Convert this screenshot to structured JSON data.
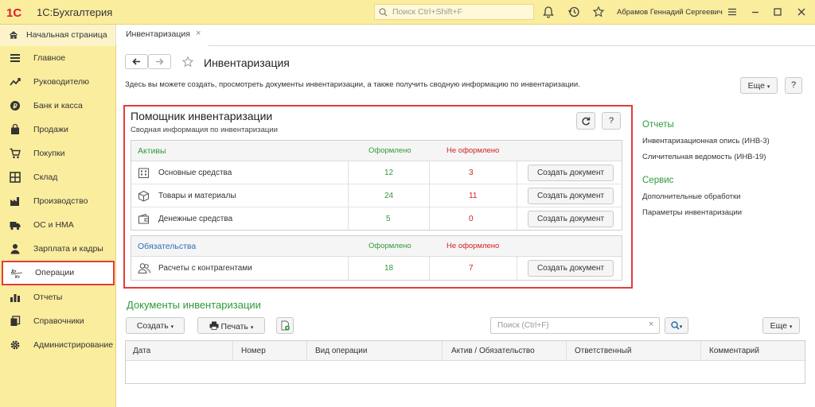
{
  "app": {
    "logo_text": "1С",
    "name": "1С:Бухгалтерия",
    "search_placeholder": "Поиск Ctrl+Shift+F",
    "user": "Абрамов Геннадий Сергеевич"
  },
  "tabs": {
    "home": "Начальная страница",
    "active": "Инвентаризация",
    "close": "×"
  },
  "sidebar": {
    "items": [
      {
        "label": "Главное",
        "icon": "menu-icon"
      },
      {
        "label": "Руководителю",
        "icon": "trend-icon"
      },
      {
        "label": "Банк и касса",
        "icon": "coin-icon"
      },
      {
        "label": "Продажи",
        "icon": "bag-icon"
      },
      {
        "label": "Покупки",
        "icon": "cart-icon"
      },
      {
        "label": "Склад",
        "icon": "warehouse-icon"
      },
      {
        "label": "Производство",
        "icon": "factory-icon"
      },
      {
        "label": "ОС и НМА",
        "icon": "truck-icon"
      },
      {
        "label": "Зарплата и кадры",
        "icon": "person-icon"
      },
      {
        "label": "Операции",
        "icon": "dt-kt-icon",
        "icon_text": [
          "Дт",
          "Кт"
        ]
      },
      {
        "label": "Отчеты",
        "icon": "bar-chart-icon"
      },
      {
        "label": "Справочники",
        "icon": "books-icon"
      },
      {
        "label": "Администрирование",
        "icon": "gear-icon"
      }
    ]
  },
  "page": {
    "title": "Инвентаризация",
    "description": "Здесь вы можете создать, просмотреть документы инвентаризации, а также получить сводную информацию по инвентаризации.",
    "more_button": "Еще",
    "help_button": "?"
  },
  "wizard": {
    "title": "Помощник инвентаризации",
    "subtitle": "Сводная информация по инвентаризации",
    "refresh_icon": "refresh-icon",
    "help_button": "?",
    "assets": {
      "header": "Активы",
      "col_done": "Оформлено",
      "col_notdone": "Не оформлено",
      "rows": [
        {
          "label": "Основные средства",
          "done": "12",
          "notdone": "3",
          "action": "Создать документ"
        },
        {
          "label": "Товары и материалы",
          "done": "24",
          "notdone": "11",
          "action": "Создать документ"
        },
        {
          "label": "Денежные средства",
          "done": "5",
          "notdone": "0",
          "action": "Создать документ"
        }
      ]
    },
    "liabilities": {
      "header": "Обязательства",
      "col_done": "Оформлено",
      "col_notdone": "Не оформлено",
      "rows": [
        {
          "label": "Расчеты с контрагентами",
          "done": "18",
          "notdone": "7",
          "action": "Создать документ"
        }
      ]
    }
  },
  "side_panel": {
    "reports_title": "Отчеты",
    "reports": [
      "Инвентаризационная опись (ИНВ-3)",
      "Сличительная ведомость (ИНВ-19)"
    ],
    "service_title": "Сервис",
    "service": [
      "Дополнительные обработки",
      "Параметры инвентаризации"
    ]
  },
  "documents": {
    "title": "Документы инвентаризации",
    "create_button": "Создать",
    "print_button": "Печать",
    "search_placeholder": "Поиск (Ctrl+F)",
    "clear": "×",
    "more_button": "Еще",
    "columns": [
      "Дата",
      "Номер",
      "Вид операции",
      "Актив / Обязательство",
      "Ответственный",
      "Комментарий"
    ]
  },
  "colors": {
    "accent_yellow": "#fbed9e",
    "highlight_red": "#e53b3b",
    "green": "#2f9a3b",
    "red": "#d21f1f",
    "blue": "#2b6db8"
  }
}
